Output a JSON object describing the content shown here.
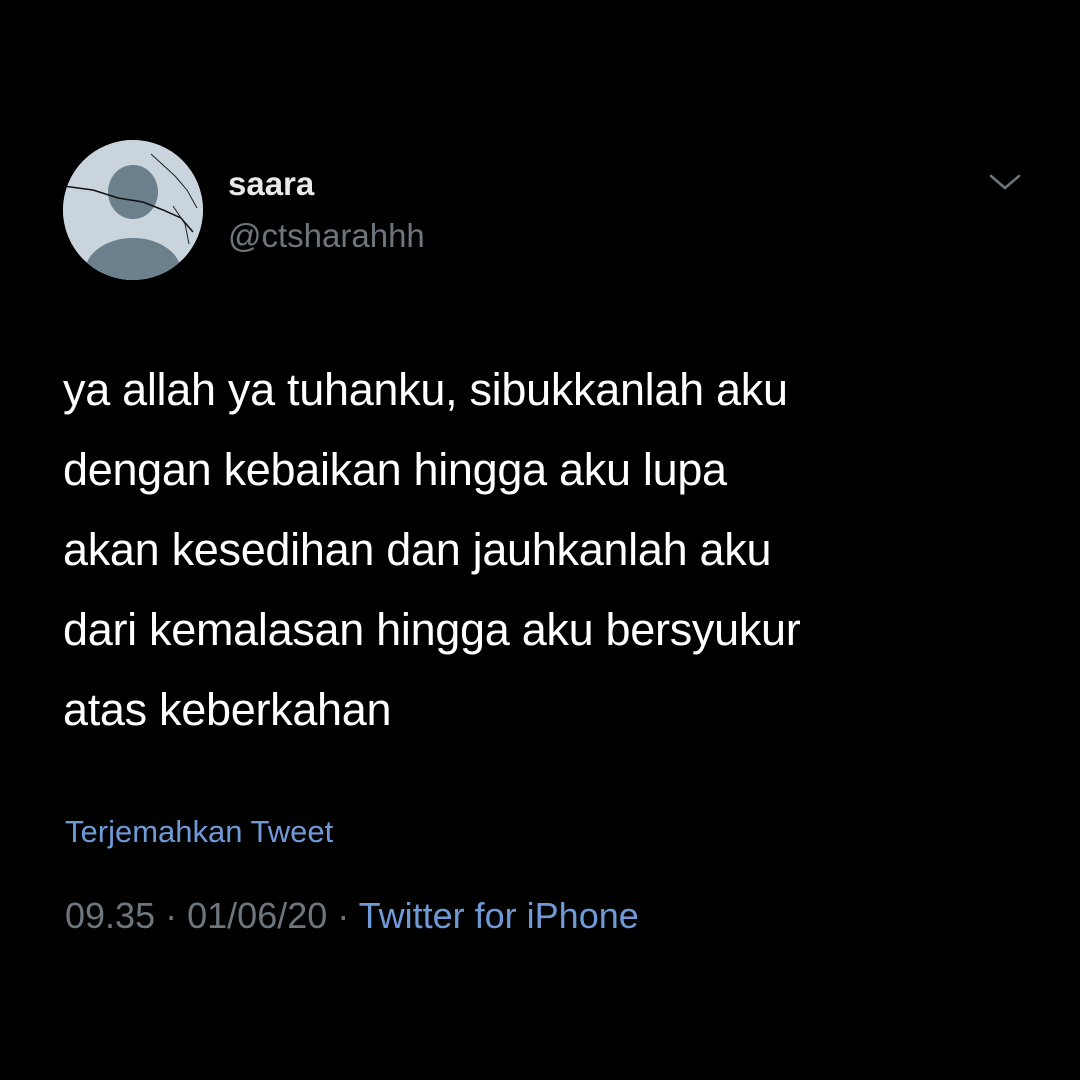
{
  "tweet": {
    "author": {
      "display_name": "saara",
      "handle": "@ctsharahhh",
      "avatar_icon": "default-profile-icon"
    },
    "menu_icon": "chevron-down-icon",
    "text_lines": [
      "ya allah ya tuhanku, sibukkanlah aku",
      "dengan kebaikan hingga aku lupa",
      "akan kesedihan dan jauhkanlah aku",
      "dari kemalasan hingga aku bersyukur",
      "atas keberkahan"
    ],
    "translate_label": "Terjemahkan Tweet",
    "time": "09.35",
    "separator": "·",
    "date": "01/06/20",
    "source": "Twitter for iPhone"
  },
  "colors": {
    "background": "#000000",
    "text_primary": "#ffffff",
    "text_secondary": "#6e767d",
    "link": "#6f9ad6"
  }
}
